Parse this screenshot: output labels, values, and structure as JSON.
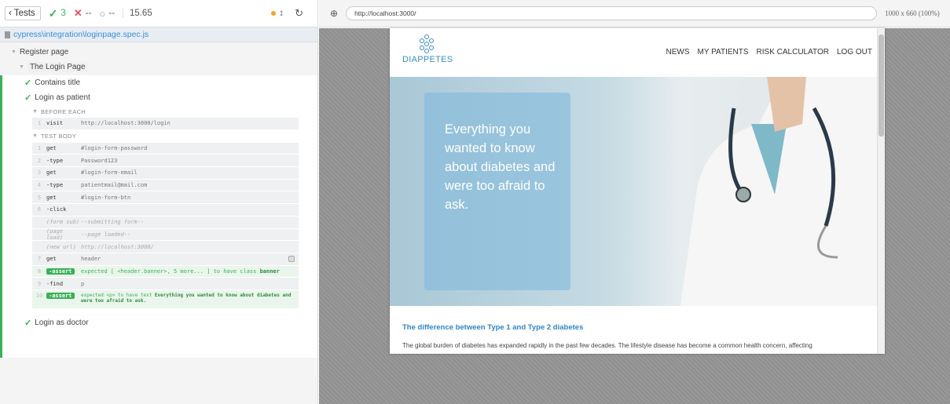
{
  "reporter": {
    "tests_label": "Tests",
    "passed": "3",
    "failed": "--",
    "pending": "--",
    "duration": "15.65",
    "spec_path": "cypress\\integration\\loginpage.spec.js",
    "suite": "Register page",
    "subsuite": "The Login Page",
    "tests": [
      {
        "title": "Contains title"
      },
      {
        "title": "Login as patient"
      },
      {
        "title": "Login as doctor"
      }
    ],
    "before_each_label": "BEFORE EACH",
    "test_body_label": "TEST BODY",
    "before_cmds": [
      {
        "num": "1",
        "name": "visit",
        "msg": "http://localhost:3000/login"
      }
    ],
    "body_cmds": [
      {
        "num": "1",
        "name": "get",
        "msg": "#login-form-password"
      },
      {
        "num": "2",
        "name": "-type",
        "msg": "Password123"
      },
      {
        "num": "3",
        "name": "get",
        "msg": "#login-form-email"
      },
      {
        "num": "4",
        "name": "-type",
        "msg": "patientmail@mail.com"
      },
      {
        "num": "5",
        "name": "get",
        "msg": "#login-form-btn"
      },
      {
        "num": "6",
        "name": "-click",
        "msg": ""
      },
      {
        "num": "",
        "name": "(form sub)",
        "msg": "--submitting form--"
      },
      {
        "num": "",
        "name": "(page load)",
        "msg": "--page loaded--"
      },
      {
        "num": "",
        "name": "(new url)",
        "msg": "http://localhost:3000/"
      },
      {
        "num": "7",
        "name": "get",
        "msg": "header"
      },
      {
        "num": "8",
        "name": "-assert",
        "msg_pre": "expected [ <header.banner>, 5 more... ] to have class ",
        "msg_bold": "banner"
      },
      {
        "num": "9",
        "name": "-find",
        "msg": "p"
      },
      {
        "num": "10",
        "name": "-assert",
        "msg_pre": "expected <p> to have text ",
        "msg_bold": "Everything you wanted to know about diabetes and were too afraid to ask."
      }
    ]
  },
  "aut": {
    "url": "http://localhost:3000/",
    "viewport": "1000 x 660 (100%)"
  },
  "site": {
    "logo_text": "DIAPPETES",
    "menu": [
      "NEWS",
      "MY PATIENTS",
      "RISK CALCULATOR",
      "LOG OUT"
    ],
    "hero_text": "Everything you wanted to know about diabetes and were too afraid to ask.",
    "article_title": "The difference between Type 1 and Type 2 diabetes",
    "article_text": "The global burden of diabetes has expanded rapidly in the past few decades. The lifestyle disease has become a common health concern, affecting"
  }
}
